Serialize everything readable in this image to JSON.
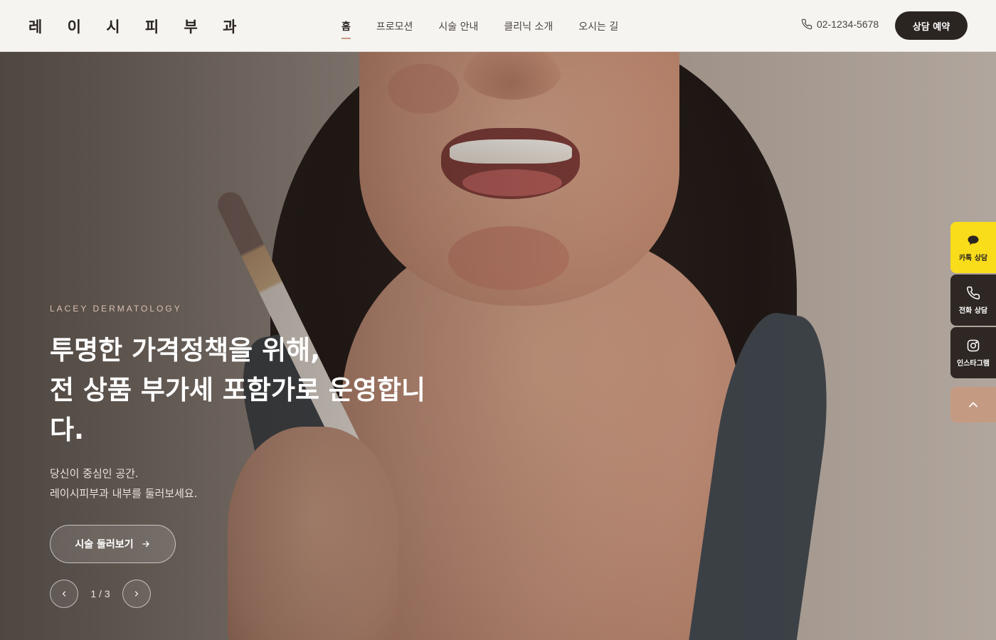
{
  "header": {
    "logo": "레 이 시 피 부 과",
    "nav": [
      {
        "label": "홈",
        "active": true
      },
      {
        "label": "프로모션",
        "active": false
      },
      {
        "label": "시술 안내",
        "active": false
      },
      {
        "label": "클리닉 소개",
        "active": false
      },
      {
        "label": "오시는 길",
        "active": false
      }
    ],
    "phone": "02-1234-5678",
    "cta_label": "상담 예약"
  },
  "hero": {
    "eyebrow": "LACEY DERMATOLOGY",
    "headline_lines": [
      "투명한 가격정책을 위해,",
      "전 상품 부가세 포함가로 운영합니",
      "다."
    ],
    "sub_lines": [
      "당신이 중심인 공간.",
      "레이시피부과 내부를 둘러보세요."
    ],
    "tour_button": "시술 둘러보기",
    "slide_counter": "1 / 3"
  },
  "side_buttons": {
    "kakao": "카톡 상담",
    "tel": "전화 상담",
    "insta": "인스타그램"
  },
  "colors": {
    "accent": "#c79a83",
    "dark": "#2b2522",
    "kakao": "#f9dc1a"
  }
}
